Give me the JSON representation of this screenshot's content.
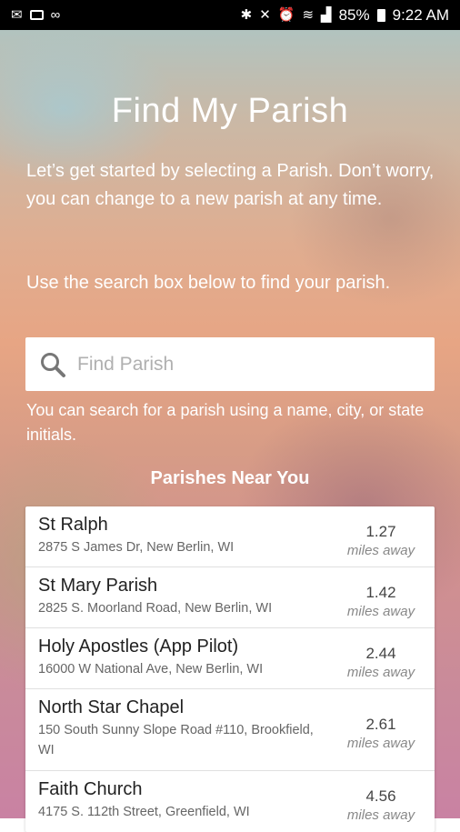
{
  "status_bar": {
    "battery": "85%",
    "time": "9:22 AM"
  },
  "page": {
    "title": "Find My Parish",
    "intro": "Let’s get started by selecting a Parish. Don’t worry, you can change to a new parish at any time.",
    "search_instruction": "Use the search box below to find your parish.",
    "search_placeholder": "Find Parish",
    "search_hint": "You can search for a parish using a name, city, or state initials.",
    "near_title": "Parishes Near You",
    "distance_unit": "miles away"
  },
  "parishes": [
    {
      "name": "St Ralph",
      "address": "2875 S James Dr, New Berlin, WI",
      "distance": "1.27"
    },
    {
      "name": "St Mary Parish",
      "address": "2825 S. Moorland Road, New Berlin, WI",
      "distance": "1.42"
    },
    {
      "name": "Holy Apostles (App Pilot)",
      "address": "16000 W National Ave, New Berlin, WI",
      "distance": "2.44"
    },
    {
      "name": "North Star Chapel",
      "address": "150 South Sunny Slope Road #110, Brookfield, WI",
      "distance": "2.61"
    },
    {
      "name": "Faith Church",
      "address": "4175 S. 112th Street, Greenfield, WI",
      "distance": "4.56"
    }
  ]
}
